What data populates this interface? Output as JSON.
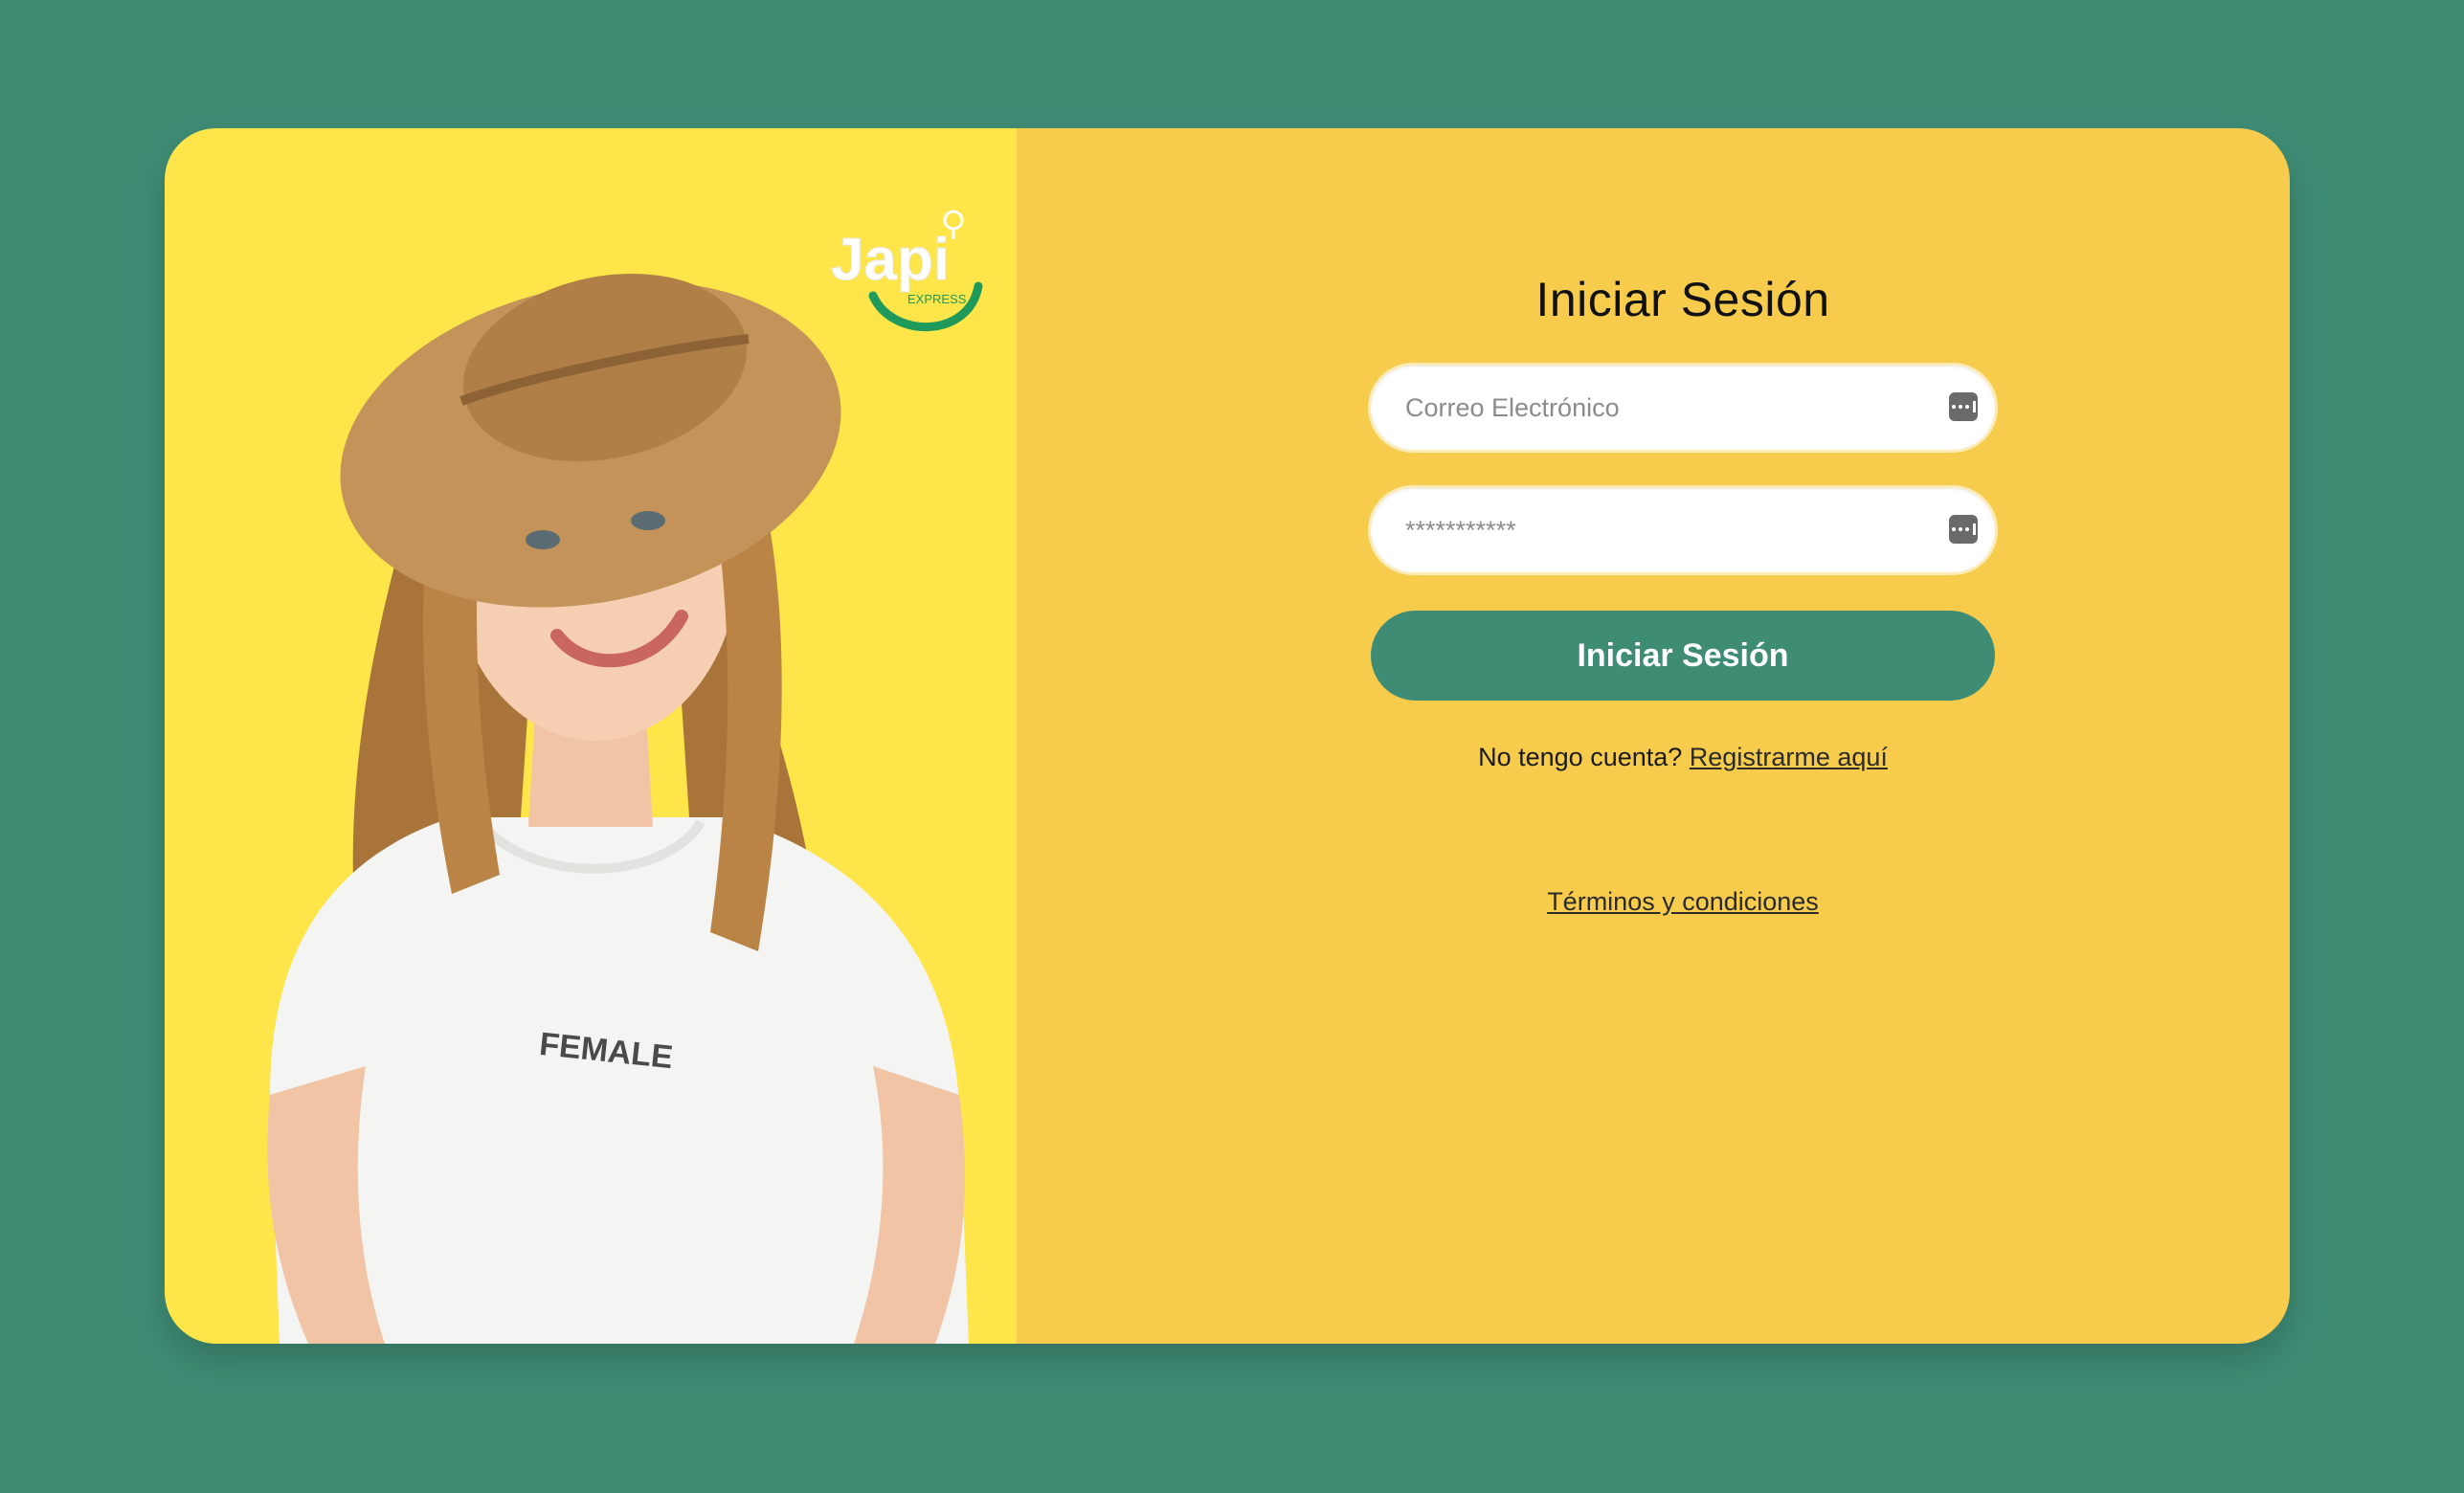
{
  "brand": {
    "logo_text": "Japi",
    "logo_subtext": "EXPRESS"
  },
  "hero": {
    "shirt_text": "FEMALE"
  },
  "login": {
    "title": "Iniciar Sesión",
    "email_placeholder": "Correo Electrónico",
    "password_placeholder": "***********",
    "submit_label": "Iniciar Sesión",
    "no_account_text": "No tengo cuenta?",
    "register_link": "Registrarme aquí",
    "terms_link": "Términos y condiciones"
  },
  "colors": {
    "background": "#3f8c75",
    "left_panel": "#fde54a",
    "right_panel": "#f7cc4d",
    "button": "#3f8c75",
    "logo_green": "#1f9a5a"
  },
  "icons": {
    "field_icon": "password-manager-key-icon"
  }
}
